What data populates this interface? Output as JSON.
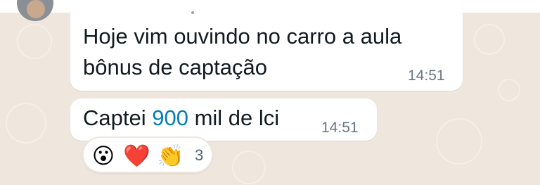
{
  "messages": [
    {
      "text_lines": [
        "Hoje vim ouvindo no carro a aula",
        "bônus de captação"
      ],
      "time": "14:51"
    },
    {
      "prefix": "Captei ",
      "highlight": "900",
      "suffix": " mil de lci",
      "time": "14:51"
    }
  ],
  "reactions": {
    "emojis": [
      "😮",
      "❤️",
      "👏"
    ],
    "count": "3"
  },
  "colors": {
    "chat_background": "#efe7de",
    "bubble": "#ffffff",
    "text": "#111b21",
    "timestamp": "#667781",
    "highlight": "#027eb5"
  },
  "icons": {
    "avatar": "avatar-icon",
    "reaction_1": "astonished-face-icon",
    "reaction_2": "red-heart-icon",
    "reaction_3": "clapping-hands-icon"
  }
}
